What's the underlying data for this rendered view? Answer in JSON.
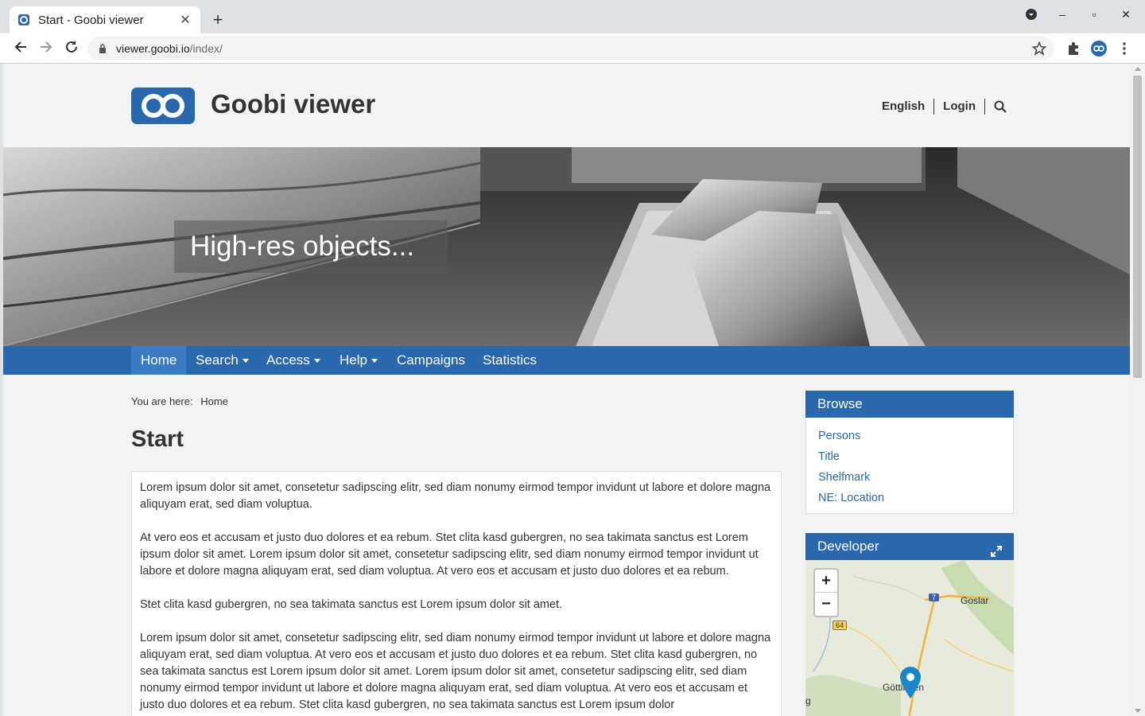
{
  "browser": {
    "tab_title": "Start - Goobi viewer",
    "url_host": "viewer.goobi.io",
    "url_path": "/index/"
  },
  "header": {
    "site_title": "Goobi viewer",
    "links": [
      "English",
      "Login"
    ]
  },
  "hero": {
    "caption": "High-res objects..."
  },
  "nav": {
    "items": [
      {
        "label": "Home",
        "dropdown": false
      },
      {
        "label": "Search",
        "dropdown": true
      },
      {
        "label": "Access",
        "dropdown": true
      },
      {
        "label": "Help",
        "dropdown": true
      },
      {
        "label": "Campaigns",
        "dropdown": false
      },
      {
        "label": "Statistics",
        "dropdown": false
      }
    ]
  },
  "breadcrumb": {
    "prefix": "You are here:",
    "home": "Home"
  },
  "page_title": "Start",
  "content": {
    "paragraphs": [
      "Lorem ipsum dolor sit amet, consetetur sadipscing elitr, sed diam nonumy eirmod tempor invidunt ut labore et dolore magna aliquyam erat, sed diam voluptua.",
      "At vero eos et accusam et justo duo dolores et ea rebum. Stet clita kasd gubergren, no sea takimata sanctus est Lorem ipsum dolor sit amet. Lorem ipsum dolor sit amet, consetetur sadipscing elitr, sed diam nonumy eirmod tempor invidunt ut labore et dolore magna aliquyam erat, sed diam voluptua. At vero eos et accusam et justo duo dolores et ea rebum.",
      "Stet clita kasd gubergren, no sea takimata sanctus est Lorem ipsum dolor sit amet.",
      "Lorem ipsum dolor sit amet, consetetur sadipscing elitr, sed diam nonumy eirmod tempor invidunt ut labore et dolore magna aliquyam erat, sed diam voluptua. At vero eos et accusam et justo duo dolores et ea rebum. Stet clita kasd gubergren, no sea takimata sanctus est Lorem ipsum dolor sit amet. Lorem ipsum dolor sit amet, consetetur sadipscing elitr, sed diam nonumy eirmod tempor invidunt ut labore et dolore magna aliquyam erat, sed diam voluptua. At vero eos et accusam et justo duo dolores et ea rebum. Stet clita kasd gubergren, no sea takimata sanctus est Lorem ipsum dolor"
    ]
  },
  "browse": {
    "title": "Browse",
    "links": [
      "Persons",
      "Title",
      "Shelfmark",
      "NE: Location"
    ]
  },
  "developer": {
    "title": "Developer",
    "zoom_in": "+",
    "zoom_out": "−",
    "map_labels": {
      "goslar": "Goslar",
      "gottingen": "Göttingen",
      "road_7": "7",
      "road_64": "64",
      "edge": "g"
    }
  },
  "colors": {
    "brand": "#2a68ae",
    "page_bg": "#f2f3f4"
  },
  "icons": [
    "search-icon",
    "back-arrow-icon",
    "forward-arrow-icon",
    "reload-icon",
    "lock-icon",
    "star-icon",
    "puzzle-icon",
    "expand-icon",
    "map-marker-icon"
  ]
}
